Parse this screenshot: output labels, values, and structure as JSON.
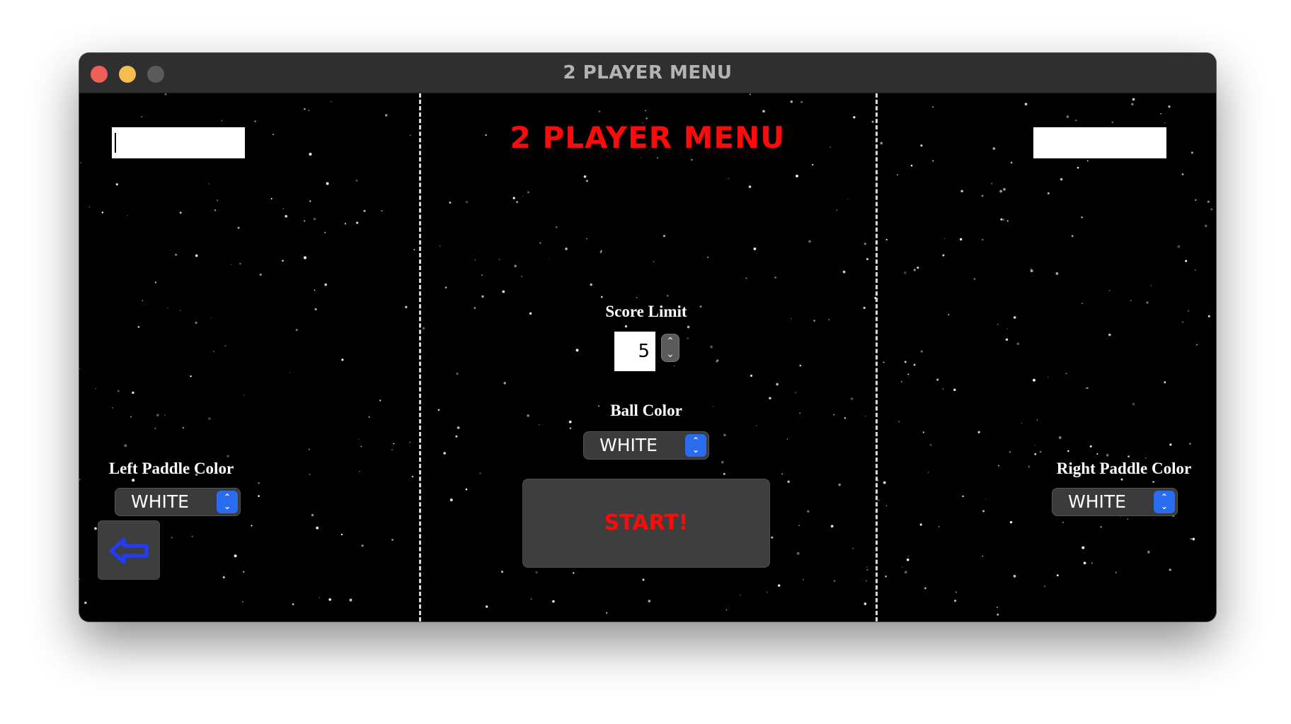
{
  "window": {
    "title": "2 PLAYER MENU"
  },
  "menu": {
    "heading": "2 PLAYER MENU",
    "left_name": {
      "value": ""
    },
    "right_name": {
      "value": ""
    },
    "score_limit": {
      "label": "Score Limit",
      "value": "5"
    },
    "ball_color": {
      "label": "Ball Color",
      "value": "WHITE"
    },
    "left_paddle_color": {
      "label": "Left Paddle Color",
      "value": "WHITE"
    },
    "right_paddle_color": {
      "label": "Right Paddle Color",
      "value": "WHITE"
    },
    "start_label": "START!"
  },
  "icons": {
    "back": "back-arrow-icon",
    "stepper_up": "chevron-up-icon",
    "stepper_down": "chevron-down-icon",
    "select": "up-down-chevron-icon"
  },
  "colors": {
    "heading": "#ff0a0a",
    "start_text": "#ff0a0a",
    "select_accent": "#2a6cf0",
    "back_arrow": "#1f3cff",
    "background": "#000000"
  }
}
